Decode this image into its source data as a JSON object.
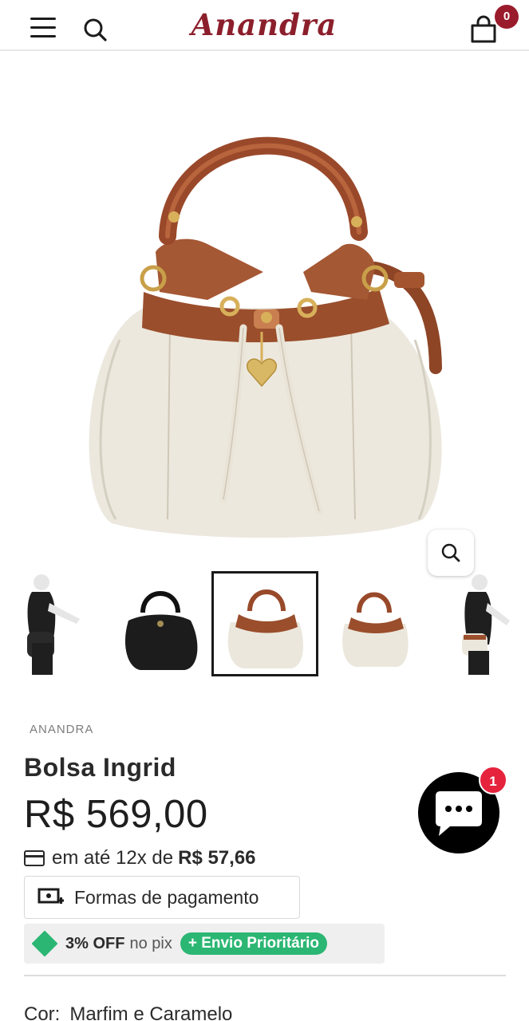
{
  "header": {
    "logo_text": "Anandra",
    "cart_count": "0",
    "accent_color": "#8c1f2c"
  },
  "gallery": {
    "thumbnails": [
      {
        "name": "model-side-black-bag"
      },
      {
        "name": "black-bucket-bag"
      },
      {
        "name": "ivory-caramel-bucket-bag",
        "selected": true
      },
      {
        "name": "ivory-caramel-bucket-bag-angle"
      },
      {
        "name": "model-side-ivory-bag"
      }
    ]
  },
  "product": {
    "brand": "ANANDRA",
    "title": "Bolsa Ingrid",
    "price": "R$ 569,00",
    "installments_prefix": "em até 12x de",
    "installments_value": "R$ 57,66",
    "payment_button": "Formas de pagamento",
    "promo_off": "3% OFF",
    "promo_pix": "no pix",
    "promo_tag": "+ Envio Prioritário",
    "color_label": "Cor:",
    "color_value": "Marfim e Caramelo"
  },
  "chat": {
    "badge_count": "1"
  },
  "colors": {
    "brand": "#8c1f2c",
    "badge": "#9a1b2b",
    "promo_green": "#2bb673",
    "chat_badge": "#e5233d"
  }
}
